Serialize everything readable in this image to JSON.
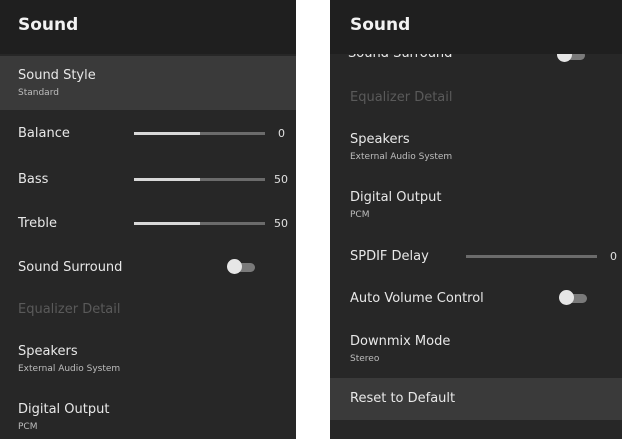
{
  "left_panel": {
    "title": "Sound",
    "sound_style": {
      "label": "Sound Style",
      "value": "Standard"
    },
    "balance": {
      "label": "Balance",
      "value": "0",
      "fill": 0.5
    },
    "bass": {
      "label": "Bass",
      "value": "50",
      "fill": 0.5
    },
    "treble": {
      "label": "Treble",
      "value": "50",
      "fill": 0.5
    },
    "sound_surround": {
      "label": "Sound Surround",
      "on": false
    },
    "equalizer_detail": {
      "label": "Equalizer Detail"
    },
    "speakers": {
      "label": "Speakers",
      "value": "External Audio System"
    },
    "digital_output": {
      "label": "Digital Output",
      "value": "PCM"
    }
  },
  "right_panel": {
    "title": "Sound",
    "sound_surround": {
      "label": "Sound Surround",
      "on": false
    },
    "equalizer_detail": {
      "label": "Equalizer Detail"
    },
    "speakers": {
      "label": "Speakers",
      "value": "External Audio System"
    },
    "digital_output": {
      "label": "Digital Output",
      "value": "PCM"
    },
    "spdif_delay": {
      "label": "SPDIF Delay",
      "value": "0",
      "fill": 0
    },
    "auto_volume_control": {
      "label": "Auto Volume Control",
      "on": false
    },
    "downmix_mode": {
      "label": "Downmix Mode",
      "value": "Stereo"
    },
    "reset_to_default": {
      "label": "Reset to Default"
    }
  }
}
